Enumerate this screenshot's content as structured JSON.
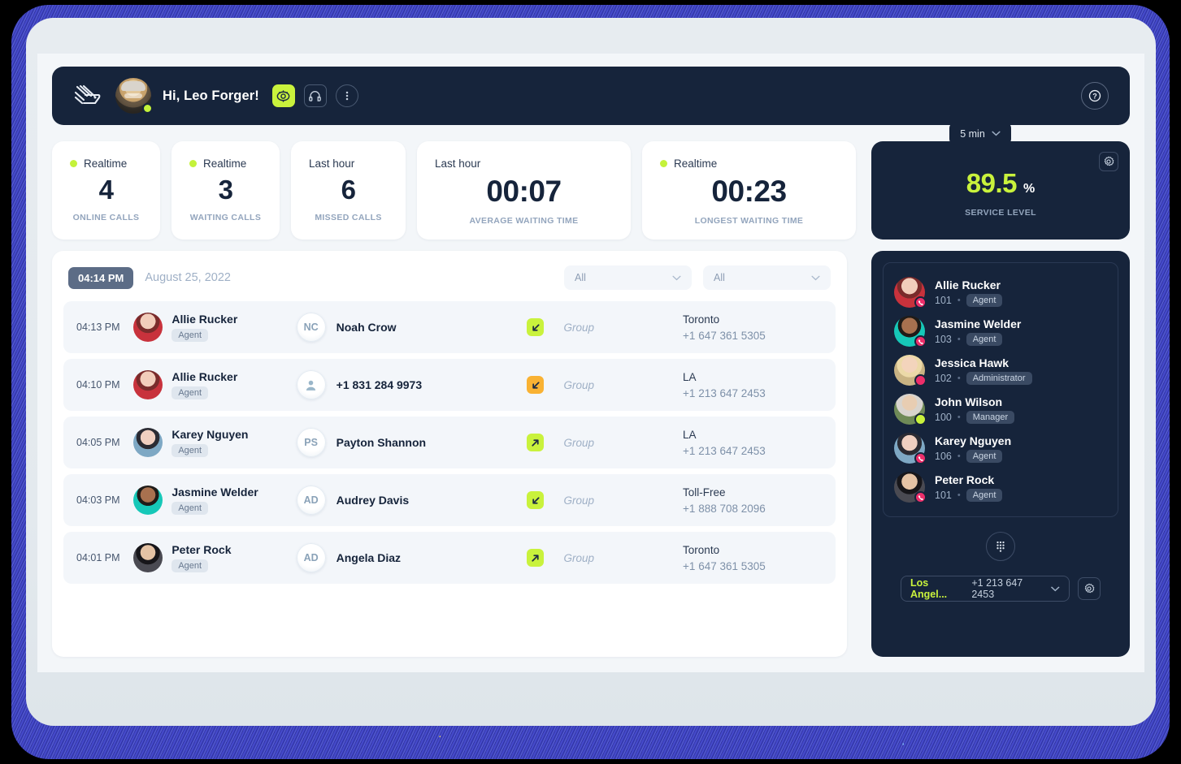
{
  "header": {
    "logo_icon": "dog-head-logo-icon",
    "greeting": "Hi, Leo Forger!",
    "avatar_status": "online",
    "buttons": {
      "eye": "eye-icon",
      "headset": "headset-icon",
      "more": "more-vertical-icon",
      "help": "?"
    }
  },
  "kpis": [
    {
      "period": "Realtime",
      "live": true,
      "value": "4",
      "label": "ONLINE CALLS"
    },
    {
      "period": "Realtime",
      "live": true,
      "value": "3",
      "label": "WAITING CALLS"
    },
    {
      "period": "Last hour",
      "live": false,
      "value": "6",
      "label": "MISSED CALLS"
    },
    {
      "period": "Last hour",
      "live": false,
      "value": "00:07",
      "label": "AVERAGE WAITING TIME"
    },
    {
      "period": "Realtime",
      "live": true,
      "value": "00:23",
      "label": "LONGEST WAITING TIME"
    }
  ],
  "service_level": {
    "interval": "5 min",
    "value": "89.5",
    "unit": "%",
    "label": "SERVICE LEVEL",
    "gear_icon": "gear-icon",
    "accent_color": "#c9f23c"
  },
  "calls": {
    "current_time": "04:14 PM",
    "date": "August 25, 2022",
    "filter_one": {
      "value": "All"
    },
    "filter_two": {
      "value": "All"
    },
    "rows": [
      {
        "time": "04:13 PM",
        "agent": "Allie Rucker",
        "agent_role": "Agent",
        "contact": "Noah Crow",
        "contact_initials": "NC",
        "direction": "incoming",
        "group": "Group",
        "location": "Toronto",
        "number": "+1 647 361 5305"
      },
      {
        "time": "04:10 PM",
        "agent": "Allie Rucker",
        "agent_role": "Agent",
        "contact": "+1 831 284 9973",
        "contact_initials": "",
        "direction": "missed",
        "group": "Group",
        "location": "LA",
        "number": "+1 213 647 2453"
      },
      {
        "time": "04:05 PM",
        "agent": "Karey Nguyen",
        "agent_role": "Agent",
        "contact": "Payton Shannon",
        "contact_initials": "PS",
        "direction": "outgoing",
        "group": "Group",
        "location": "LA",
        "number": "+1 213 647 2453"
      },
      {
        "time": "04:03 PM",
        "agent": "Jasmine Welder",
        "agent_role": "Agent",
        "contact": "Audrey Davis",
        "contact_initials": "AD",
        "direction": "incoming",
        "group": "Group",
        "location": "Toll-Free",
        "number": "+1 888 708 2096"
      },
      {
        "time": "04:01 PM",
        "agent": "Peter Rock",
        "agent_role": "Agent",
        "contact": "Angela Diaz",
        "contact_initials": "AD",
        "direction": "outgoing",
        "group": "Group",
        "location": "Toronto",
        "number": "+1 647 361 5305"
      }
    ]
  },
  "agents": {
    "list": [
      {
        "name": "Allie Rucker",
        "ext": "101",
        "role": "Agent",
        "status": "on-call"
      },
      {
        "name": "Jasmine Welder",
        "ext": "103",
        "role": "Agent",
        "status": "on-call"
      },
      {
        "name": "Jessica Hawk",
        "ext": "102",
        "role": "Administrator",
        "status": "busy"
      },
      {
        "name": "John Wilson",
        "ext": "100",
        "role": "Manager",
        "status": "available"
      },
      {
        "name": "Karey Nguyen",
        "ext": "106",
        "role": "Agent",
        "status": "on-call"
      },
      {
        "name": "Peter Rock",
        "ext": "101",
        "role": "Agent",
        "status": "on-call"
      }
    ],
    "separator": "•",
    "dialpad_icon": "dialpad-icon",
    "phone_line": {
      "city": "Los Angel...",
      "number": "+1 213 647 2453"
    },
    "phone_gear_icon": "gear-icon"
  },
  "colors": {
    "lime": "#c9f23c",
    "amber": "#f9b233",
    "navy": "#16243b",
    "pink": "#ed2e6a"
  }
}
